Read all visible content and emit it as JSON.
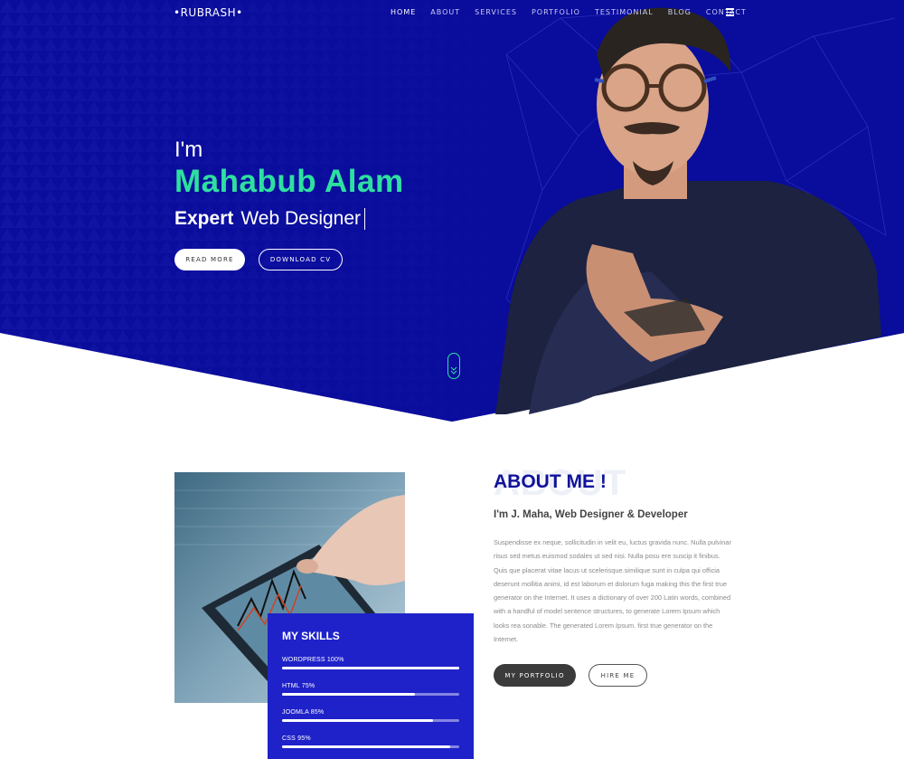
{
  "nav": {
    "logo": "•RUBRASH•",
    "links": [
      "HOME",
      "ABOUT",
      "SERVICES",
      "PORTFOLIO",
      "TESTIMONIAL",
      "BLOG",
      "CONTACT"
    ],
    "active": "HOME"
  },
  "hero": {
    "greeting": "I'm",
    "name": "Mahabub Alam",
    "role_prefix": "Expert",
    "role": "Web Designer",
    "read_more": "READ MORE",
    "download_cv": "DOWNLOAD CV"
  },
  "about": {
    "bg_word": "ABOUT",
    "title": "ABOUT ME !",
    "subtitle": "I'm J. Maha, Web Designer & Developer",
    "text": "Suspendisse ex neque, sollicitudin in velit eu, luctus gravida nunc. Nulla pulvinar risus sed metus euismod sodales ut sed nisi. Nulla posu ere suscip it finibus. Quis que placerat vitae lacus ut scelerisque.similique sunt in culpa qui officia deserunt mollitia animi, id est laborum et dolorum fuga making this the first true generator on the Internet. It uses a dictionary of over 200 Latin words, combined with a handful of model sentence structures, to generate Lorem Ipsum which looks rea sonable. The generated Lorem Ipsum. first true generator on the Internet.",
    "portfolio_btn": "MY PORTFOLIO",
    "hire_btn": "HIRE ME"
  },
  "skills": {
    "title": "MY SKILLS",
    "items": [
      {
        "label": "WORDPRESS  100%",
        "percent": 100
      },
      {
        "label": "HTML  75%",
        "percent": 75
      },
      {
        "label": "JOOMLA  85%",
        "percent": 85
      },
      {
        "label": "CSS  95%",
        "percent": 95
      }
    ]
  },
  "colors": {
    "hero_bg": "#0a0c9c",
    "accent_green": "#2ee0a0",
    "skills_bg": "#1f22c9",
    "title_blue": "#10129a"
  }
}
